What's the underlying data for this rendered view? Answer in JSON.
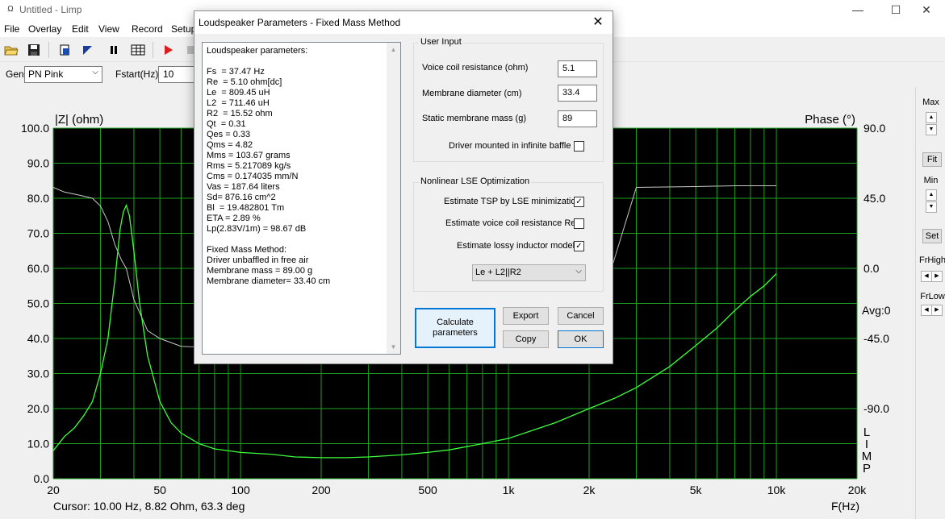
{
  "window": {
    "app_icon": "Ω",
    "title": "Untitled - Limp",
    "min": "—",
    "max": "☐",
    "close": "✕"
  },
  "menu": [
    "File",
    "Overlay",
    "Edit",
    "View",
    "Record",
    "Setup"
  ],
  "gen": {
    "label": "Gen",
    "value": "PN Pink",
    "fstart_label": "Fstart(Hz)",
    "fstart_value": "10"
  },
  "graph": {
    "ylabel_left": "|Z| (ohm)",
    "ylabel_right": "Phase (°)",
    "xlabel": "F(Hz)",
    "cursor": "Cursor: 10.00 Hz, 8.82 Ohm, 63.3 deg",
    "avg": "Avg:0",
    "limp": [
      "L",
      "I",
      "M",
      "P"
    ],
    "colors": {
      "background": "#000000",
      "grid": "#1f9f1f",
      "impedance": "#3cff3c",
      "phase": "#c8c8c8"
    }
  },
  "chart_data": {
    "type": "line",
    "x_scale": "log",
    "xlim": [
      20,
      20000
    ],
    "ylim": [
      0,
      100
    ],
    "phase_lim": [
      -135,
      90
    ],
    "x_ticks": [
      "20",
      "50",
      "100",
      "200",
      "500",
      "1k",
      "2k",
      "5k",
      "10k",
      "20k"
    ],
    "y_ticks": [
      "100.0",
      "90.0",
      "80.0",
      "70.0",
      "60.0",
      "50.0",
      "40.0",
      "30.0",
      "20.0",
      "10.0",
      "0.0"
    ],
    "phase_ticks": [
      "90.0",
      "45.0",
      "0.0",
      "-45.0",
      "-90.0"
    ],
    "series": [
      {
        "axis": "impedance",
        "x": [
          20,
          22,
          24,
          26,
          28,
          30,
          32,
          34,
          35.5,
          36.5,
          37.47,
          38.5,
          40,
          42,
          45,
          50,
          55,
          60,
          70,
          80,
          100,
          130,
          160,
          200,
          250,
          300,
          400,
          500,
          600,
          800,
          1000,
          1200,
          1500,
          2000,
          2500,
          3000,
          4000,
          5000,
          6000,
          7000,
          8000,
          9000,
          10000
        ],
        "y": [
          8.0,
          12.0,
          14.5,
          18.0,
          22.0,
          30.0,
          40.0,
          57.0,
          71.0,
          76.0,
          78.0,
          75.0,
          65.0,
          50.0,
          35.0,
          22.0,
          16.0,
          13.0,
          10.0,
          8.5,
          7.5,
          7.0,
          6.2,
          6.0,
          6.0,
          6.2,
          6.8,
          7.5,
          8.2,
          10.0,
          11.5,
          13.5,
          16.0,
          20.0,
          23.0,
          26.0,
          32.0,
          38.0,
          43.0,
          48.0,
          52.0,
          55.0,
          58.5
        ]
      },
      {
        "axis": "phase",
        "x": [
          20,
          22,
          25,
          28,
          30,
          32,
          34,
          36,
          37.47,
          40,
          45,
          50,
          60,
          70,
          80,
          100,
          150,
          200,
          300,
          500,
          1000,
          2000,
          3000,
          5000,
          7000,
          10000
        ],
        "y": [
          52,
          49,
          47,
          45,
          40,
          30,
          15,
          5,
          0,
          -20,
          -40,
          -45,
          -50,
          -50.5,
          -50,
          -50,
          -48,
          -47,
          -47,
          -47,
          -47,
          -47,
          52,
          52.5,
          53,
          53
        ]
      }
    ]
  },
  "rpanel": {
    "max": "Max",
    "fit": "Fit",
    "min": "Min",
    "set": "Set",
    "frhigh": "FrHigh",
    "frlow": "FrLow"
  },
  "dialog": {
    "title": "Loudspeaker Parameters - Fixed Mass Method",
    "close": "✕",
    "results": [
      "Loudspeaker parameters:",
      "",
      "Fs  = 37.47 Hz",
      "Re  = 5.10 ohm[dc]",
      "Le  = 809.45 uH",
      "L2  = 711.46 uH",
      "R2  = 15.52 ohm",
      "Qt  = 0.31",
      "Qes = 0.33",
      "Qms = 4.82",
      "Mms = 103.67 grams",
      "Rms = 5.217089 kg/s",
      "Cms = 0.174035 mm/N",
      "Vas = 187.64 liters",
      "Sd= 876.16 cm^2",
      "Bl  = 19.482801 Tm",
      "ETA = 2.89 %",
      "Lp(2.83V/1m) = 98.67 dB",
      "",
      "Fixed Mass Method:",
      "Driver unbaffled in free air",
      "Membrane mass = 89.00 g",
      "Membrane diameter= 33.40 cm"
    ],
    "user_input": {
      "title": "User Input",
      "voice_coil_label": "Voice coil resistance (ohm)",
      "voice_coil_value": "5.1",
      "membrane_diam_label": "Membrane diameter (cm)",
      "membrane_diam_value": "33.4",
      "static_mass_label": "Static membrane mass (g)",
      "static_mass_value": "89",
      "infinite_baffle_label": "Driver mounted in infinite baffle",
      "infinite_baffle_checked": false
    },
    "lse": {
      "title": "Nonlinear LSE Optimization",
      "tsp_label": "Estimate TSP by LSE minimization",
      "tsp_checked": true,
      "re_label": "Estimate voice coil resistance Re",
      "re_checked": false,
      "lossy_label": "Estimate lossy inductor model",
      "lossy_checked": true,
      "model_value": "Le + L2||R2"
    },
    "buttons": {
      "calculate_1": "Calculate",
      "calculate_2": "parameters",
      "export": "Export",
      "cancel": "Cancel",
      "copy": "Copy",
      "ok": "OK"
    }
  }
}
